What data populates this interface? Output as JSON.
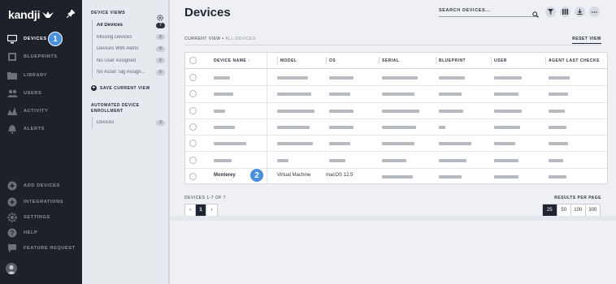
{
  "brand": {
    "name": "kandji"
  },
  "nav": {
    "top_items": [
      {
        "label": "Devices",
        "icon": "monitor-icon",
        "active": true
      },
      {
        "label": "Blueprints",
        "icon": "blueprint-icon",
        "active": false
      },
      {
        "label": "Library",
        "icon": "folder-icon",
        "active": false
      },
      {
        "label": "Users",
        "icon": "users-icon",
        "active": false
      },
      {
        "label": "Activity",
        "icon": "activity-icon",
        "active": false
      },
      {
        "label": "Alerts",
        "icon": "bell-icon",
        "active": false
      }
    ],
    "bottom_items": [
      {
        "label": "Add Devices",
        "icon": "plus-circle-icon"
      },
      {
        "label": "Integrations",
        "icon": "integrations-icon"
      },
      {
        "label": "Settings",
        "icon": "gear-icon"
      },
      {
        "label": "Help",
        "icon": "help-icon"
      },
      {
        "label": "Feature Request",
        "icon": "chat-icon"
      }
    ],
    "devices_badge": "1"
  },
  "subnav": {
    "device_views_title": "Device Views",
    "views": [
      {
        "label": "All Devices",
        "count": "7",
        "active": true
      },
      {
        "label": "Missing Devices",
        "count": "0",
        "active": false
      },
      {
        "label": "Devices With Alerts",
        "count": "0",
        "active": false
      },
      {
        "label": "No User Assigned",
        "count": "0",
        "active": false
      },
      {
        "label": "No Asset Tag Assign...",
        "count": "0",
        "active": false
      }
    ],
    "save_view_label": "Save Current View",
    "ade_title_line1": "Automated Device",
    "ade_title_line2": "Enrollment",
    "ade_items": [
      {
        "label": "Devices",
        "count": "3"
      }
    ]
  },
  "main": {
    "title": "Devices",
    "search_placeholder": "Search Devices...",
    "current_view_label": "Current View",
    "current_view_value": "All Devices",
    "reset_view": "Reset View",
    "columns": [
      "Device Name",
      "Model",
      "OS",
      "Serial",
      "Blueprint",
      "User",
      "Agent Last Checke"
    ],
    "visible_row": {
      "name": "Monterey",
      "model": "Virtual Machine",
      "os": "macOS 12.5"
    },
    "row_badge": "2",
    "device_count": "Devices 1-7 of 7",
    "page": "1",
    "results_per_page_label": "Results per page",
    "page_sizes": [
      "25",
      "50",
      "100",
      "300"
    ],
    "active_page_size": "25"
  }
}
